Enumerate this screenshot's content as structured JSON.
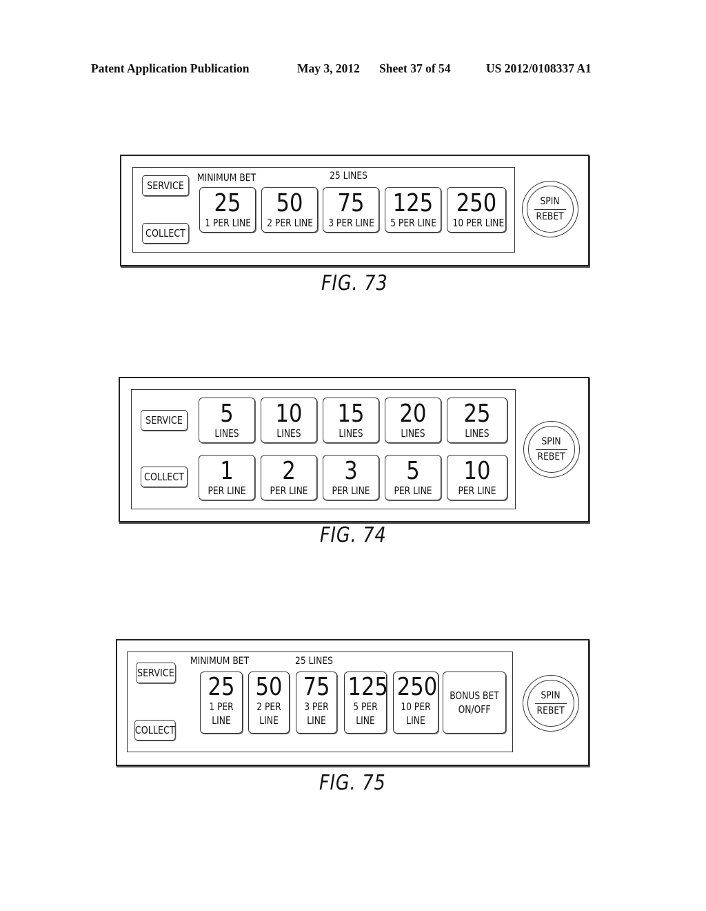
{
  "header": {
    "publication": "Patent Application Publication",
    "date": "May 3, 2012",
    "sheet": "Sheet 37 of 54",
    "number": "US 2012/0108337 A1"
  },
  "fig73": {
    "caption": "FIG. 73",
    "service": "SERVICE",
    "collect": "COLLECT",
    "min_bet_label": "MINIMUM BET",
    "lines_label": "25 LINES",
    "bets": [
      {
        "value": "25",
        "sub": "1 PER LINE"
      },
      {
        "value": "50",
        "sub": "2 PER LINE"
      },
      {
        "value": "75",
        "sub": "3 PER LINE"
      },
      {
        "value": "125",
        "sub": "5 PER LINE"
      },
      {
        "value": "250",
        "sub": "10 PER LINE"
      }
    ],
    "spin": "SPIN",
    "rebet": "REBET"
  },
  "fig74": {
    "caption": "FIG. 74",
    "service": "SERVICE",
    "collect": "COLLECT",
    "lines": [
      {
        "value": "5",
        "sub": "LINES"
      },
      {
        "value": "10",
        "sub": "LINES"
      },
      {
        "value": "15",
        "sub": "LINES"
      },
      {
        "value": "20",
        "sub": "LINES"
      },
      {
        "value": "25",
        "sub": "LINES"
      }
    ],
    "per_line": [
      {
        "value": "1",
        "sub": "PER LINE"
      },
      {
        "value": "2",
        "sub": "PER LINE"
      },
      {
        "value": "3",
        "sub": "PER LINE"
      },
      {
        "value": "5",
        "sub": "PER LINE"
      },
      {
        "value": "10",
        "sub": "PER LINE"
      }
    ],
    "spin": "SPIN",
    "rebet": "REBET"
  },
  "fig75": {
    "caption": "FIG. 75",
    "service": "SERVICE",
    "collect": "COLLECT",
    "min_bet_label": "MINIMUM BET",
    "lines_label": "25 LINES",
    "bets": [
      {
        "value": "25",
        "sub1": "1 PER",
        "sub2": "LINE"
      },
      {
        "value": "50",
        "sub1": "2 PER",
        "sub2": "LINE"
      },
      {
        "value": "75",
        "sub1": "3 PER",
        "sub2": "LINE"
      },
      {
        "value": "125",
        "sub1": "5 PER",
        "sub2": "LINE"
      },
      {
        "value": "250",
        "sub1": "10 PER",
        "sub2": "LINE"
      }
    ],
    "bonus_line1": "BONUS BET",
    "bonus_line2": "ON/OFF",
    "spin": "SPIN",
    "rebet": "REBET"
  }
}
